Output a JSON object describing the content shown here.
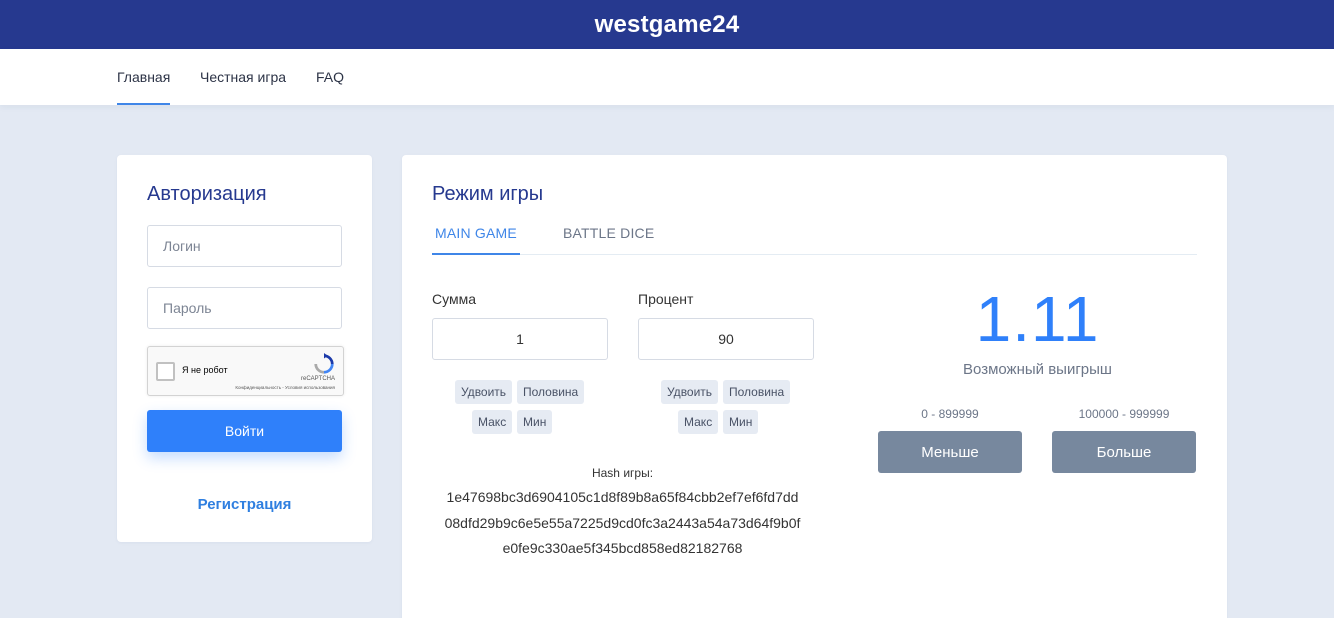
{
  "site": {
    "title": "westgame24"
  },
  "nav": {
    "items": [
      "Главная",
      "Честная игра",
      "FAQ"
    ]
  },
  "auth": {
    "title": "Авторизация",
    "login_placeholder": "Логин",
    "password_placeholder": "Пароль",
    "captcha": {
      "label": "Я не робот",
      "brand": "reCAPTCHA",
      "terms": "Конфиденциальность - Условия использования"
    },
    "submit_label": "Войти",
    "register_label": "Регистрация"
  },
  "game": {
    "title": "Режим игры",
    "tabs": [
      "MAIN GAME",
      "BATTLE DICE"
    ],
    "amount": {
      "label": "Сумма",
      "value": "1"
    },
    "percent": {
      "label": "Процент",
      "value": "90"
    },
    "amount_buttons": {
      "double": "Удвоить",
      "half": "Половина",
      "max": "Макс",
      "min": "Мин"
    },
    "percent_buttons": {
      "double": "Удвоить",
      "half": "Половина",
      "max": "Макс",
      "min": "Мин"
    },
    "hash": {
      "label": "Hash игры:",
      "lines": [
        "1e47698bc3d6904105c1d8f89b8a65f84cbb2ef7ef6fd7dd",
        "08dfd29b9c6e5e55a7225d9cd0fc3a2443a54a73d64f9b0f",
        "e0fe9c330ae5f345bcd858ed82182768"
      ]
    },
    "multiplier": "1.11",
    "payout_label": "Возможный выигрыш",
    "less": {
      "range": "0 - 899999",
      "label": "Меньше"
    },
    "more": {
      "range": "100000 - 999999",
      "label": "Больше"
    }
  },
  "colors": {
    "header": "#26398f",
    "accent": "#2f80fa",
    "grey_button": "#77889e",
    "background": "#e3e9f3"
  }
}
